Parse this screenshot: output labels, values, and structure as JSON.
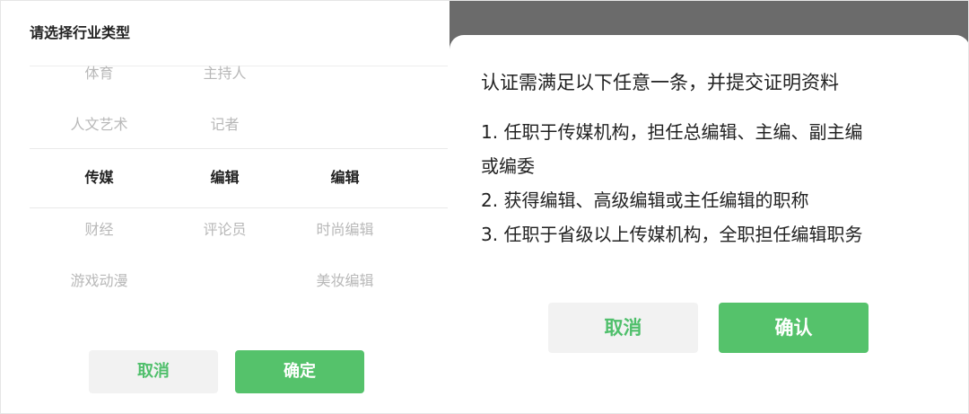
{
  "left_panel": {
    "title": "请选择行业类型",
    "rows": [
      [
        "体育",
        "主持人",
        ""
      ],
      [
        "人文艺术",
        "记者",
        ""
      ],
      [
        "传媒",
        "编辑",
        "编辑"
      ],
      [
        "财经",
        "评论员",
        "时尚编辑"
      ],
      [
        "游戏动漫",
        "",
        "美妆编辑"
      ]
    ],
    "selected_row": 2,
    "cancel_label": "取消",
    "confirm_label": "确定"
  },
  "right_panel": {
    "title": "认证需满足以下任意一条，并提交证明资料",
    "requirements": [
      "1. 任职于传媒机构，担任总编辑、主编、副主编",
      "或编委",
      "2. 获得编辑、高级编辑或主任编辑的职称",
      "3. 任职于省级以上传媒机构，全职担任编辑职务"
    ],
    "cancel_label": "取消",
    "confirm_label": "确认"
  },
  "colors": {
    "accent_green": "#55c26b",
    "overlay_gray": "#6b6b6b"
  }
}
